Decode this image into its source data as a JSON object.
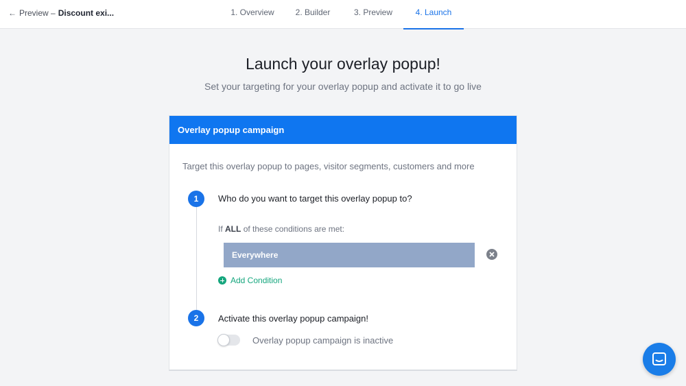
{
  "topbar": {
    "back_arrow": "←",
    "back_label": "Preview –",
    "back_title": "Discount exi...",
    "steps": [
      {
        "label": "1. Overview"
      },
      {
        "label": "2. Builder"
      },
      {
        "label": "3. Preview"
      },
      {
        "label": "4. Launch"
      }
    ],
    "active_step": "4. Launch"
  },
  "page": {
    "title": "Launch your overlay popup!",
    "subtitle": "Set your targeting for your overlay popup and activate it to go live"
  },
  "card": {
    "header": "Overlay popup campaign",
    "description": "Target this overlay popup to pages, visitor segments, customers and more",
    "step1": {
      "number": "1",
      "title": "Who do you want to target this overlay popup to?",
      "condition_prefix": "If",
      "condition_bold": "ALL",
      "condition_suffix": "of these conditions are met:",
      "condition_value": "Everywhere",
      "add_condition": "Add Condition"
    },
    "step2": {
      "number": "2",
      "title": "Activate this overlay popup campaign!",
      "toggle_label": "Overlay popup campaign is inactive",
      "toggle_on": false
    }
  },
  "colors": {
    "accent": "#1a73e8",
    "header_bg": "#0f76f0",
    "condition_bg": "#92a7c8",
    "add_green": "#15a67d"
  }
}
